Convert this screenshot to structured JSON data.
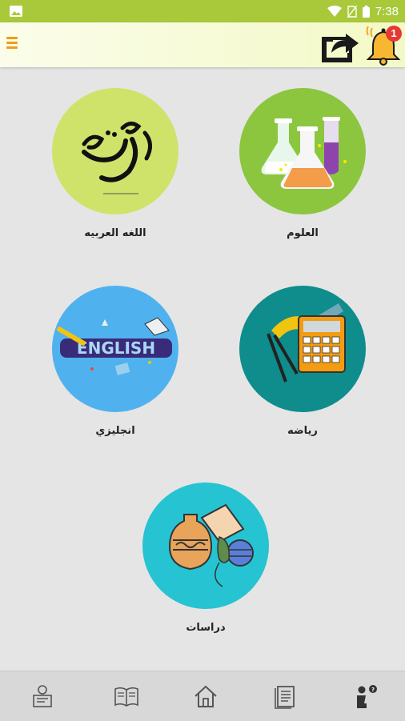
{
  "status_bar": {
    "time": "7:38"
  },
  "header": {
    "notification_count": "1",
    "icons": {
      "menu": "hamburger-menu-icon",
      "share": "share-icon",
      "bell": "bell-icon"
    }
  },
  "subjects": [
    {
      "id": "science",
      "label": "العلوم",
      "bg": "#8cc63f",
      "icon": "lab-flasks-icon"
    },
    {
      "id": "arabic",
      "label": "اللغه العربيه",
      "bg": "#cfe36a",
      "icon": "arabic-calligraphy-icon",
      "art_text": "عربي"
    },
    {
      "id": "math",
      "label": "رياضه",
      "bg": "#0f8c8c",
      "icon": "calculator-geometry-icon"
    },
    {
      "id": "english",
      "label": "انجليزي",
      "bg": "#4fb2ef",
      "icon": "english-word-art-icon",
      "art_text": "ENGLISH"
    },
    {
      "id": "studies",
      "label": "دراسات",
      "bg": "#26c3d3",
      "icon": "history-artifacts-icon"
    }
  ],
  "bottom_nav": [
    "teacher-board-icon",
    "open-book-icon",
    "home-icon",
    "notebook-icon",
    "student-question-icon"
  ],
  "colors": {
    "status_bar": "#a9c93a",
    "accent": "#f39c12",
    "badge": "#e53935"
  }
}
